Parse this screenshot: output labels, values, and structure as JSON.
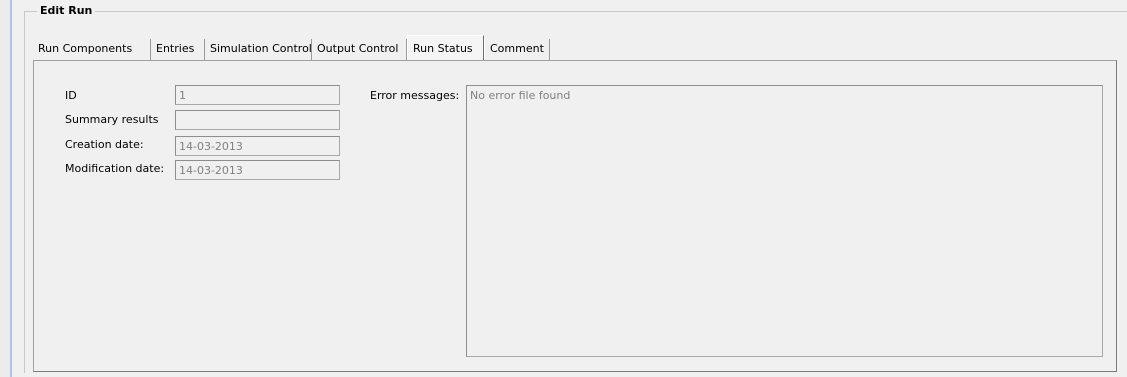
{
  "group": {
    "title": "Edit Run"
  },
  "tabs": [
    {
      "label": "Run Components"
    },
    {
      "label": "Entries"
    },
    {
      "label": "Simulation Control"
    },
    {
      "label": "Output Control"
    },
    {
      "label": "Run Status"
    },
    {
      "label": "Comment"
    }
  ],
  "active_tab": "Run Status",
  "fields": {
    "id_label": "ID",
    "id_value": "1",
    "summary_label": "Summary results",
    "summary_value": "",
    "creation_label": "Creation date:",
    "creation_value": "14-03-2013",
    "modification_label": "Modification date:",
    "modification_value": "14-03-2013"
  },
  "errors": {
    "label": "Error messages:",
    "value": "No error file found"
  }
}
